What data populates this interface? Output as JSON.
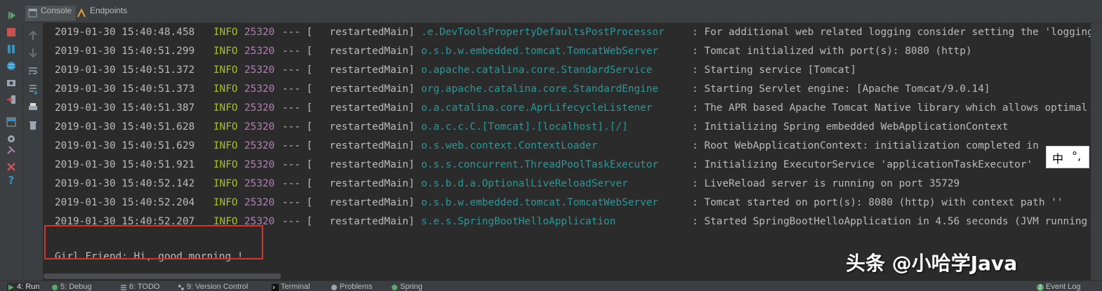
{
  "tabs": [
    {
      "label": "Console",
      "icon": "console-icon",
      "active": true
    },
    {
      "label": "Endpoints",
      "icon": "endpoints-icon",
      "active": false
    }
  ],
  "log_lines": [
    {
      "ts": "2019-01-30 15:40:48.458",
      "level": "INFO",
      "pid": "25320",
      "sep": "--- [",
      "thread": "  restartedMain]",
      "logger": ".e.DevToolsPropertyDefaultsPostProcessor",
      "msg": ": For additional web related logging consider setting the 'logging"
    },
    {
      "ts": "2019-01-30 15:40:51.299",
      "level": "INFO",
      "pid": "25320",
      "sep": "--- [",
      "thread": "  restartedMain]",
      "logger": "o.s.b.w.embedded.tomcat.TomcatWebServer",
      "msg": ": Tomcat initialized with port(s): 8080 (http)"
    },
    {
      "ts": "2019-01-30 15:40:51.372",
      "level": "INFO",
      "pid": "25320",
      "sep": "--- [",
      "thread": "  restartedMain]",
      "logger": "o.apache.catalina.core.StandardService",
      "msg": ": Starting service [Tomcat]"
    },
    {
      "ts": "2019-01-30 15:40:51.373",
      "level": "INFO",
      "pid": "25320",
      "sep": "--- [",
      "thread": "  restartedMain]",
      "logger": "org.apache.catalina.core.StandardEngine",
      "msg": ": Starting Servlet engine: [Apache Tomcat/9.0.14]"
    },
    {
      "ts": "2019-01-30 15:40:51.387",
      "level": "INFO",
      "pid": "25320",
      "sep": "--- [",
      "thread": "  restartedMain]",
      "logger": "o.a.catalina.core.AprLifecycleListener",
      "msg": ": The APR based Apache Tomcat Native library which allows optimal"
    },
    {
      "ts": "2019-01-30 15:40:51.628",
      "level": "INFO",
      "pid": "25320",
      "sep": "--- [",
      "thread": "  restartedMain]",
      "logger": "o.a.c.c.C.[Tomcat].[localhost].[/]",
      "msg": ": Initializing Spring embedded WebApplicationContext"
    },
    {
      "ts": "2019-01-30 15:40:51.629",
      "level": "INFO",
      "pid": "25320",
      "sep": "--- [",
      "thread": "  restartedMain]",
      "logger": "o.s.web.context.ContextLoader",
      "msg": ": Root WebApplicationContext: initialization completed in"
    },
    {
      "ts": "2019-01-30 15:40:51.921",
      "level": "INFO",
      "pid": "25320",
      "sep": "--- [",
      "thread": "  restartedMain]",
      "logger": "o.s.s.concurrent.ThreadPoolTaskExecutor",
      "msg": ": Initializing ExecutorService 'applicationTaskExecutor'"
    },
    {
      "ts": "2019-01-30 15:40:52.142",
      "level": "INFO",
      "pid": "25320",
      "sep": "--- [",
      "thread": "  restartedMain]",
      "logger": "o.s.b.d.a.OptionalLiveReloadServer",
      "msg": ": LiveReload server is running on port 35729"
    },
    {
      "ts": "2019-01-30 15:40:52.204",
      "level": "INFO",
      "pid": "25320",
      "sep": "--- [",
      "thread": "  restartedMain]",
      "logger": "o.s.b.w.embedded.tomcat.TomcatWebServer",
      "msg": ": Tomcat started on port(s): 8080 (http) with context path ''"
    },
    {
      "ts": "2019-01-30 15:40:52.207",
      "level": "INFO",
      "pid": "25320",
      "sep": "--- [",
      "thread": "  restartedMain]",
      "logger": "s.e.s.SpringBootHelloApplication",
      "msg": ": Started SpringBootHelloApplication in 4.56 seconds (JVM running"
    }
  ],
  "output_line": "Girl Friend: Hi, good morning !",
  "ime": {
    "char1": "中",
    "char2": "°,"
  },
  "watermark": "头条 @小哈学Java",
  "statusbar": [
    {
      "label": "4: Run",
      "icon": "run-icon",
      "active": true
    },
    {
      "label": "5: Debug",
      "icon": "debug-icon"
    },
    {
      "label": "6: TODO",
      "icon": "todo-icon"
    },
    {
      "label": "9: Version Control",
      "icon": "version-control-icon"
    },
    {
      "label": "Terminal",
      "icon": "terminal-icon"
    },
    {
      "label": "Problems",
      "icon": "problems-icon"
    },
    {
      "label": "Spring",
      "icon": "spring-icon"
    }
  ],
  "event_log": {
    "label": "Event Log",
    "badge": "2"
  },
  "colors": {
    "level": "#a8c023",
    "pid": "#b07fb3",
    "logger": "#299999",
    "highlight": "#d9342b"
  }
}
